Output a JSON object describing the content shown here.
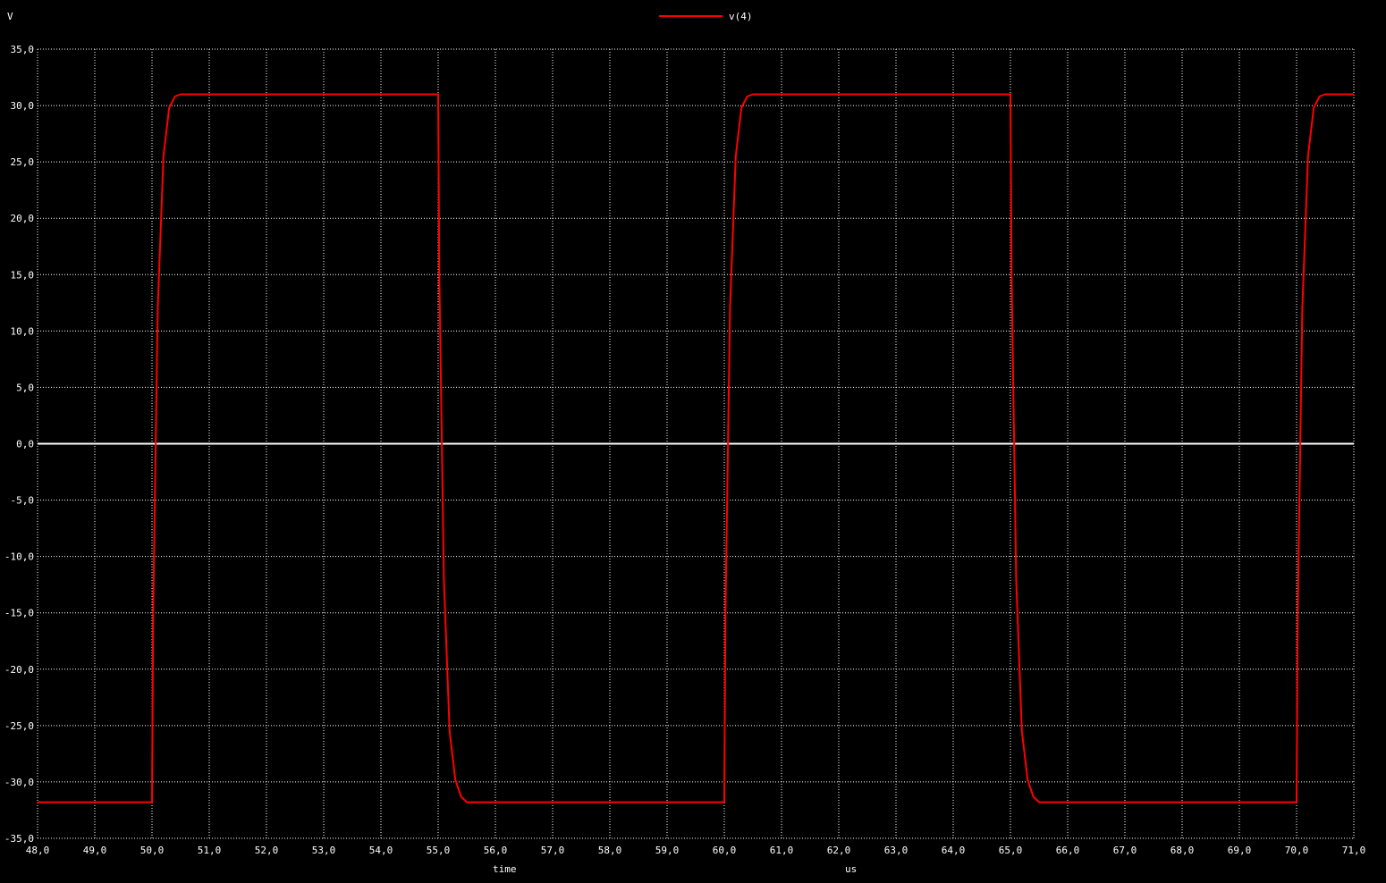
{
  "chart_data": {
    "type": "line",
    "ylabel": "V",
    "xlabel": "time",
    "xunit": "us",
    "xlim": [
      48.0,
      71.0
    ],
    "ylim": [
      -35.0,
      35.0
    ],
    "xticks": [
      "48,0",
      "49,0",
      "50,0",
      "51,0",
      "52,0",
      "53,0",
      "54,0",
      "55,0",
      "56,0",
      "57,0",
      "58,0",
      "59,0",
      "60,0",
      "61,0",
      "62,0",
      "63,0",
      "64,0",
      "65,0",
      "66,0",
      "67,0",
      "68,0",
      "69,0",
      "70,0",
      "71,0"
    ],
    "yticks": [
      "35,0",
      "30,0",
      "25,0",
      "20,0",
      "15,0",
      "10,0",
      "5,0",
      "0,0",
      "-5,0",
      "-10,0",
      "-15,0",
      "-20,0",
      "-25,0",
      "-30,0",
      "-35,0"
    ],
    "grid": true,
    "legend_position": "top-center",
    "series": [
      {
        "name": "v(4)",
        "color": "#ff0000",
        "x": [
          48.0,
          50.0,
          50.02,
          50.1,
          50.2,
          50.3,
          50.4,
          50.5,
          55.0,
          55.02,
          55.1,
          55.2,
          55.3,
          55.4,
          55.5,
          60.0,
          60.02,
          60.1,
          60.2,
          60.3,
          60.4,
          60.5,
          65.0,
          65.02,
          65.1,
          65.2,
          65.3,
          65.4,
          65.5,
          70.0,
          70.02,
          70.1,
          70.2,
          70.3,
          70.4,
          70.5,
          71.0
        ],
        "y": [
          -31.8,
          -31.8,
          -15.0,
          12.0,
          25.5,
          29.8,
          30.8,
          31.0,
          31.0,
          15.0,
          -12.0,
          -25.5,
          -29.8,
          -31.3,
          -31.8,
          -31.8,
          -15.0,
          12.0,
          25.5,
          29.8,
          30.8,
          31.0,
          31.0,
          15.0,
          -12.0,
          -25.5,
          -29.8,
          -31.3,
          -31.8,
          -31.8,
          -15.0,
          12.0,
          25.5,
          29.8,
          30.8,
          31.0,
          31.0
        ]
      }
    ],
    "zero_line_color": "#ffffff",
    "grid_color": "#ffffff",
    "background": "#000000"
  }
}
